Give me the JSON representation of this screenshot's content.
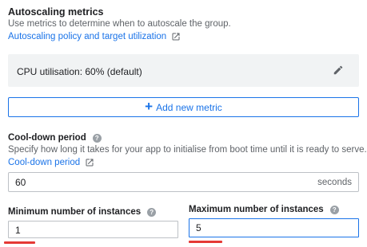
{
  "autoscaling": {
    "title": "Autoscaling metrics",
    "description": "Use metrics to determine when to autoscale the group.",
    "policy_link": "Autoscaling policy and target utilization",
    "metric_label": "CPU utilisation: 60% (default)",
    "add_metric_label": "Add new metric"
  },
  "cooldown": {
    "title": "Cool-down period",
    "description": "Specify how long it takes for your app to initialise from boot time until it is ready to serve.",
    "link": "Cool-down period",
    "value": "60",
    "unit": "seconds"
  },
  "instances": {
    "min_label": "Minimum number of instances",
    "min_value": "1",
    "max_label": "Maximum number of instances",
    "max_value": "5"
  },
  "icons": {
    "external": "open-in-new-icon",
    "edit": "pencil-icon",
    "help": "question-mark-circle-icon",
    "add": "plus-icon",
    "help_glyph": "?",
    "plus_glyph": "+"
  },
  "colors": {
    "link": "#1a73e8",
    "annotation": "#e53935",
    "card_bg": "#f1f3f4"
  }
}
